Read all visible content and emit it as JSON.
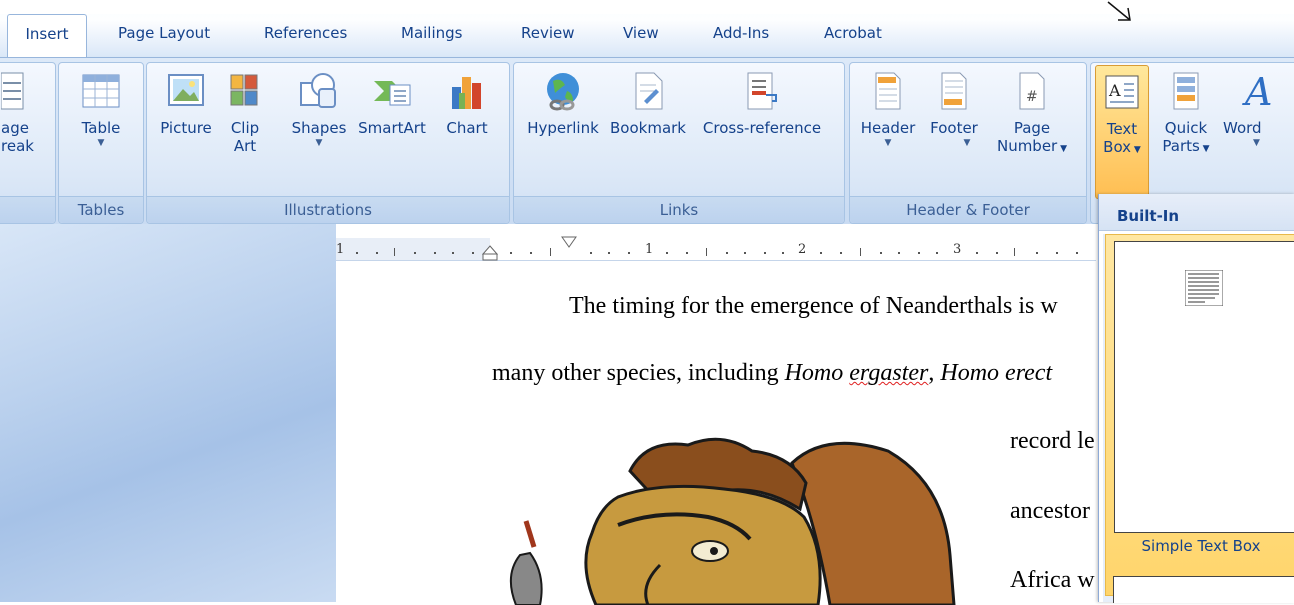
{
  "tabs": [
    {
      "label": "Insert",
      "active": true
    },
    {
      "label": "Page Layout"
    },
    {
      "label": "References"
    },
    {
      "label": "Mailings"
    },
    {
      "label": "Review"
    },
    {
      "label": "View"
    },
    {
      "label": "Add-Ins"
    },
    {
      "label": "Acrobat"
    }
  ],
  "ribbon": {
    "pages": {
      "break_line1": "age",
      "break_line2": "reak"
    },
    "tables": {
      "table": "Table",
      "group": "Tables"
    },
    "illustrations": {
      "picture": "Picture",
      "clipart_line1": "Clip",
      "clipart_line2": "Art",
      "shapes": "Shapes",
      "smartart": "SmartArt",
      "chart": "Chart",
      "group": "Illustrations"
    },
    "links": {
      "hyperlink": "Hyperlink",
      "bookmark": "Bookmark",
      "crossref": "Cross-reference",
      "group": "Links"
    },
    "headerfooter": {
      "header": "Header",
      "footer": "Footer",
      "pagenum_line1": "Page",
      "pagenum_line2": "Number",
      "group": "Header & Footer"
    },
    "text": {
      "textbox_line1": "Text",
      "textbox_line2": "Box",
      "quickparts_line1": "Quick",
      "quickparts_line2": "Parts",
      "wordart": "Word"
    }
  },
  "ruler": {
    "numbers": [
      "1",
      "1",
      "2",
      "3"
    ]
  },
  "document": {
    "line1": "The timing  for the emergence  of Neanderthals is  w",
    "line2_a": "many other species,  including ",
    "line2_b": "Homo ",
    "line2_c": "ergaster",
    "line2_d": ",  ",
    "line2_e": "Homo erect",
    "line3": "record le",
    "line4": "ancestor",
    "line5": "Africa w"
  },
  "gallery": {
    "heading": "Built-In",
    "item_label": "Simple Text Box"
  },
  "colors": {
    "accent": "#15428b",
    "ribbon_bg": "#c9dbf2",
    "highlight": "#ffd56b"
  }
}
